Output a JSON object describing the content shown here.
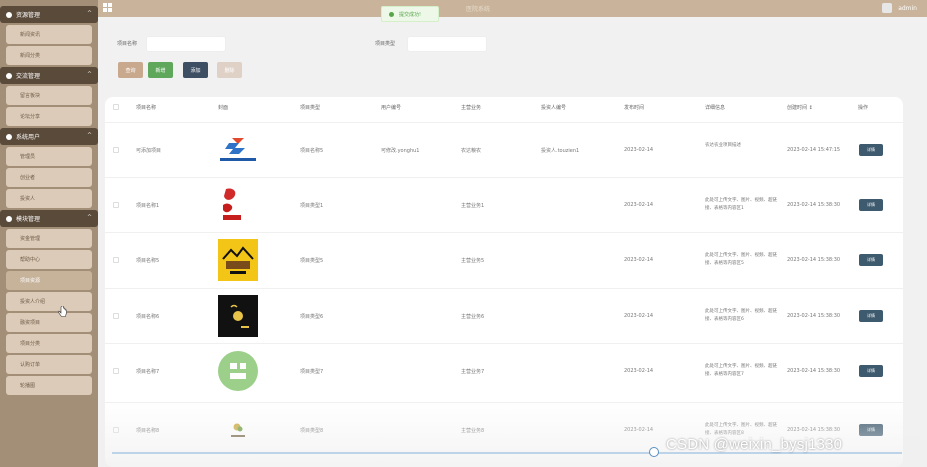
{
  "topbar": {
    "site_title": "医院系统",
    "admin": "admin"
  },
  "toast": {
    "text": "提交成功!"
  },
  "sidebar": {
    "groups": [
      {
        "label": "资源管理"
      },
      {
        "label": "交流管理"
      },
      {
        "label": "系统用户"
      },
      {
        "label": "模块管理"
      }
    ],
    "items": [
      {
        "label": "新闻资讯"
      },
      {
        "label": "新闻分类"
      },
      {
        "label": "留言板块"
      },
      {
        "label": "论坛分享"
      },
      {
        "label": "管理员"
      },
      {
        "label": "创业者"
      },
      {
        "label": "投资人"
      },
      {
        "label": "资金管理"
      },
      {
        "label": "帮助中心"
      },
      {
        "label": "项目资源"
      },
      {
        "label": "投资人介绍"
      },
      {
        "label": "融资项目"
      },
      {
        "label": "项目分类"
      },
      {
        "label": "认购订单"
      },
      {
        "label": "轮播图"
      }
    ]
  },
  "search": {
    "label_name": "项目名称",
    "label_type": "项目类型",
    "btn_query": "查询",
    "btn_add": "新增",
    "btn_add2": "添加",
    "btn_delete": "删除"
  },
  "table": {
    "headers": [
      "项目名称",
      "封面",
      "项目类型",
      "用户编号",
      "主营业务",
      "投资人编号",
      "发布时间",
      "详细信息",
      "创建时间 ↕",
      "操作"
    ],
    "detail_label": "详情",
    "rows": [
      {
        "name": "可添加项目",
        "cover": "logo-blue",
        "type": "项目名称5",
        "user": "可修改.yonghu1",
        "business": "农达粮农",
        "investor": "投资人.touzien1",
        "date": "2023-02-14",
        "remark": "农达农业项目描述",
        "created": "2023-02-14 15:47:15"
      },
      {
        "name": "项目名称1",
        "cover": "logo-red",
        "type": "项目类型1",
        "user": "",
        "business": "主营业务1",
        "investor": "",
        "date": "2023-02-14",
        "remark": "此处可上传文字、图片、视频、超链接、表格等内容区1",
        "created": "2023-02-14 15:38:30"
      },
      {
        "name": "项目名称5",
        "cover": "logo-yellow",
        "type": "项目类型5",
        "user": "",
        "business": "主营业务5",
        "investor": "",
        "date": "2023-02-14",
        "remark": "此处可上传文字、图片、视频、超链接、表格等内容区5",
        "created": "2023-02-14 15:38:30"
      },
      {
        "name": "项目名称6",
        "cover": "logo-black",
        "type": "项目类型6",
        "user": "",
        "business": "主营业务6",
        "investor": "",
        "date": "2023-02-14",
        "remark": "此处可上传文字、图片、视频、超链接、表格等内容区6",
        "created": "2023-02-14 15:38:30"
      },
      {
        "name": "项目名称7",
        "cover": "logo-green",
        "type": "项目类型7",
        "user": "",
        "business": "主营业务7",
        "investor": "",
        "date": "2023-02-14",
        "remark": "此处可上传文字、图片、视频、超链接、表格等内容区7",
        "created": "2023-02-14 15:38:30"
      },
      {
        "name": "项目名称8",
        "cover": "logo-small",
        "type": "项目类型8",
        "user": "",
        "business": "主营业务8",
        "investor": "",
        "date": "2023-02-14",
        "remark": "此处可上传文字、图片、视频、超链接、表格等内容区8",
        "created": "2023-02-14 15:38:30"
      }
    ]
  },
  "watermark": "CSDN @weixin_bysj1330",
  "colors": {
    "topbar": "#c9b39a",
    "sidebar": "#a38f78",
    "sidebar_group": "#5a4a3a",
    "detail_btn": "#3e5a6e"
  }
}
